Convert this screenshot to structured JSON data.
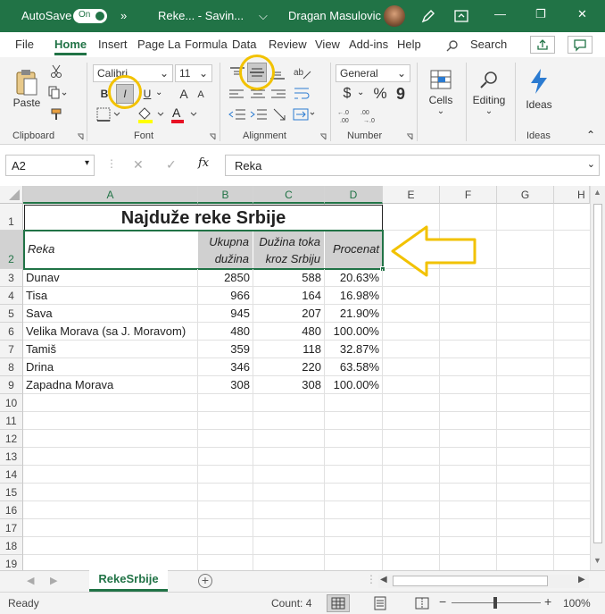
{
  "titlebar": {
    "autosave": "AutoSave",
    "autosave_state": "On",
    "more": "»",
    "filename": "Reke... - Savin...",
    "user": "Dragan Masulovic",
    "minimize": "—",
    "restore": "❐",
    "close": "✕"
  },
  "tabs": [
    "File",
    "Home",
    "Insert",
    "Page La",
    "Formula",
    "Data",
    "Review",
    "View",
    "Add-ins",
    "Help"
  ],
  "search_label": "Search",
  "ribbon": {
    "clipboard": {
      "paste": "Paste",
      "label": "Clipboard"
    },
    "font": {
      "name": "Calibri",
      "size": "11",
      "bold": "B",
      "italic": "I",
      "underline": "U",
      "grow": "A",
      "shrink": "A",
      "label": "Font"
    },
    "alignment": {
      "label": "Alignment"
    },
    "number": {
      "format": "General",
      "currency": "$",
      "percent": "%",
      "comma": "9",
      "label": "Number"
    },
    "cells": {
      "label": "Cells"
    },
    "editing": {
      "label": "Editing"
    },
    "ideas": {
      "button": "Ideas",
      "label": "Ideas"
    }
  },
  "formula_bar": {
    "name_box": "A2",
    "fx": "fx",
    "content": "Reka"
  },
  "columns": [
    "A",
    "B",
    "C",
    "D",
    "E",
    "F",
    "G",
    "H"
  ],
  "rows": [
    "1",
    "2",
    "3",
    "4",
    "5",
    "6",
    "7",
    "8",
    "9",
    "10",
    "11",
    "12",
    "13",
    "14",
    "15",
    "16",
    "17",
    "18",
    "19"
  ],
  "sheet": {
    "title": "Najduže reke Srbije",
    "headers": [
      "Reka",
      "Ukupna dužina",
      "Dužina toka kroz Srbiju",
      "Procenat"
    ],
    "header_lines": {
      "b": [
        "Ukupna",
        "dužina"
      ],
      "c": [
        "Dužina toka",
        "kroz Srbiju"
      ]
    },
    "data": [
      [
        "Dunav",
        "2850",
        "588",
        "20.63%"
      ],
      [
        "Tisa",
        "966",
        "164",
        "16.98%"
      ],
      [
        "Sava",
        "945",
        "207",
        "21.90%"
      ],
      [
        "Velika Morava (sa J. Moravom)",
        "480",
        "480",
        "100.00%"
      ],
      [
        "Tamiš",
        "359",
        "118",
        "32.87%"
      ],
      [
        "Drina",
        "346",
        "220",
        "63.58%"
      ],
      [
        "Zapadna Morava",
        "308",
        "308",
        "100.00%"
      ]
    ]
  },
  "sheet_tab": "RekeSrbije",
  "status": {
    "ready": "Ready",
    "count": "Count: 4",
    "zoom": "100%"
  },
  "colors": {
    "excel_green": "#217346",
    "highlight_yellow": "#f2c200",
    "header_fill": "#d0d0d0"
  }
}
